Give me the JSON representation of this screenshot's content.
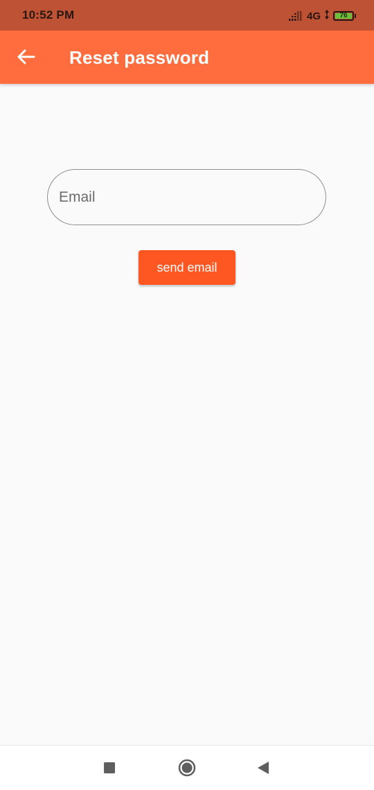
{
  "status_bar": {
    "time": "10:52 PM",
    "network": "4G",
    "battery_level": "76",
    "icons": [
      "signal-icon",
      "battery-icon"
    ]
  },
  "app_bar": {
    "title": "Reset password",
    "back_icon": "arrow-back-icon"
  },
  "form": {
    "email_placeholder": "Email",
    "email_value": "",
    "send_label": "send email"
  },
  "nav_bar": {
    "icons": [
      "recents-square-icon",
      "home-circle-icon",
      "back-triangle-icon"
    ]
  },
  "colors": {
    "status_bar": "#BE5234",
    "app_bar": "#FF6D3F",
    "button": "#FF5722",
    "background": "#FAFAFA",
    "battery_fill": "#6BBF3A"
  }
}
